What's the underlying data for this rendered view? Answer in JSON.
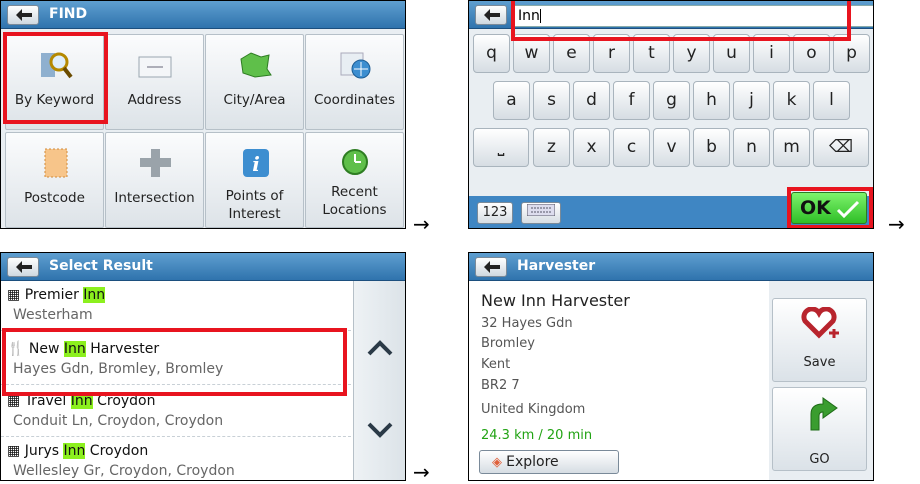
{
  "find_screen": {
    "title": "FIND",
    "tiles": [
      {
        "label": "By Keyword",
        "icon": "magnifier-icon"
      },
      {
        "label": "Address",
        "icon": "envelope-icon"
      },
      {
        "label": "City/Area",
        "icon": "map-icon"
      },
      {
        "label": "Coordinates",
        "icon": "globe-icon"
      },
      {
        "label": "Postcode",
        "icon": "stamp-icon"
      },
      {
        "label": "Intersection",
        "icon": "crossroad-icon"
      },
      {
        "label": "Points of Interest",
        "icon": "info-icon"
      },
      {
        "label": "Recent Locations",
        "icon": "clock-icon"
      }
    ]
  },
  "keyboard_screen": {
    "input_value": "Inn",
    "row1": [
      "q",
      "w",
      "e",
      "r",
      "t",
      "y",
      "u",
      "i",
      "o",
      "p"
    ],
    "row2": [
      "a",
      "s",
      "d",
      "f",
      "g",
      "h",
      "j",
      "k",
      "l"
    ],
    "row3": [
      "z",
      "x",
      "c",
      "v",
      "b",
      "n",
      "m"
    ],
    "numbers_label": "123",
    "ok_label": "OK"
  },
  "results_screen": {
    "title": "Select Result",
    "results": [
      {
        "pre": "Premier ",
        "hl": "Inn",
        "post": "",
        "sub": "Westerham"
      },
      {
        "pre": "New ",
        "hl": "Inn",
        "post": " Harvester",
        "sub": "Hayes Gdn, Bromley, Bromley"
      },
      {
        "pre": "Travel ",
        "hl": "Inn",
        "post": " Croydon",
        "sub": "Conduit Ln, Croydon, Croydon"
      },
      {
        "pre": "Jurys ",
        "hl": "Inn",
        "post": " Croydon",
        "sub": "Wellesley Gr, Croydon, Croydon"
      }
    ]
  },
  "detail_screen": {
    "title": "Harvester",
    "name": "New Inn Harvester",
    "address_lines": [
      "32 Hayes Gdn",
      "Bromley",
      "Kent",
      "BR2 7",
      "United Kingdom"
    ],
    "distance": "24.3 km / 20 min",
    "explore_label": "Explore",
    "save_label": "Save",
    "go_label": "GO"
  },
  "arrow_glyph": "→",
  "colors": {
    "highlight": "#8cf01e",
    "title_bar": "#2f73ad",
    "callout": "#e8141f",
    "distance": "#22a314"
  }
}
